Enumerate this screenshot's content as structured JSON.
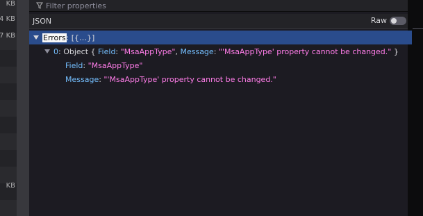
{
  "left_panel": {
    "sizes": [
      "KB",
      "4 KB",
      "7 KB",
      "KB"
    ]
  },
  "filter": {
    "placeholder": "Filter properties",
    "icon": "filter-icon"
  },
  "json_header": {
    "title": "JSON",
    "raw_label": "Raw",
    "raw_enabled": false
  },
  "tree": {
    "root": {
      "key": "Errors",
      "summary": "[{…}]"
    },
    "item0": {
      "index": "0",
      "type": "Object",
      "preview_field_key": "Field",
      "preview_field_value": "\"MsaAppType\"",
      "preview_message_key": "Message",
      "preview_message_value": "\"'MsaAppType' property cannot be changed.\""
    },
    "field": {
      "key": "Field",
      "value": "\"MsaAppType\""
    },
    "message": {
      "key": "Message",
      "value": "\"'MsaAppType' property cannot be changed.\""
    }
  },
  "colors": {
    "selected_row": "#2a4c8c",
    "key": "#75bfff",
    "string": "#ff7de9",
    "background": "#1c1b22"
  }
}
